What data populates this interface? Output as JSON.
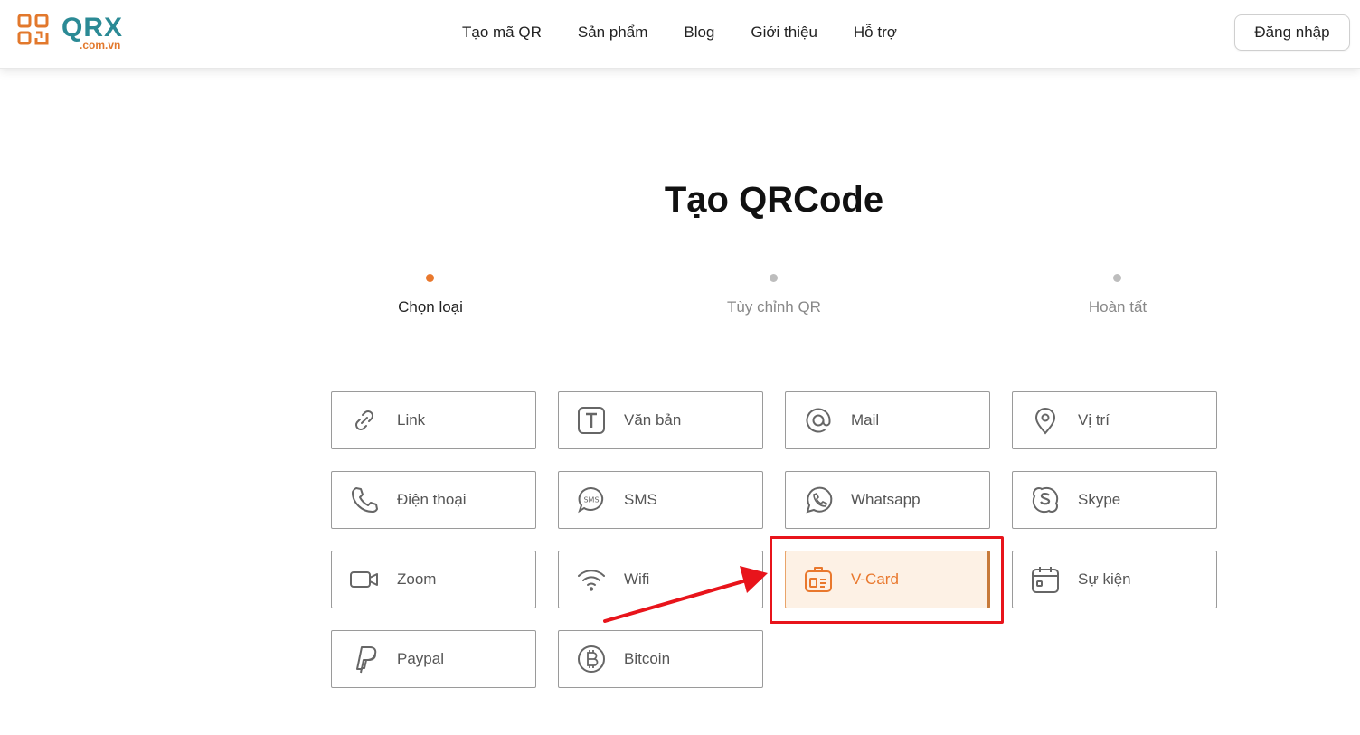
{
  "header": {
    "logo_text": "QRX",
    "logo_domain": ".com.vn",
    "nav": [
      {
        "label": "Tạo mã QR"
      },
      {
        "label": "Sản phẩm"
      },
      {
        "label": "Blog"
      },
      {
        "label": "Giới thiệu"
      },
      {
        "label": "Hỗ trợ"
      }
    ],
    "login_label": "Đăng nhập"
  },
  "main": {
    "title": "Tạo QRCode",
    "steps": [
      {
        "label": "Chọn loại",
        "active": true
      },
      {
        "label": "Tùy chỉnh QR",
        "active": false
      },
      {
        "label": "Hoàn tất",
        "active": false
      }
    ],
    "types": [
      {
        "label": "Link",
        "icon": "link-icon"
      },
      {
        "label": "Văn bản",
        "icon": "text-icon"
      },
      {
        "label": "Mail",
        "icon": "at-icon"
      },
      {
        "label": "Vị trí",
        "icon": "location-pin-icon"
      },
      {
        "label": "Điện thoại",
        "icon": "phone-icon"
      },
      {
        "label": "SMS",
        "icon": "sms-icon"
      },
      {
        "label": "Whatsapp",
        "icon": "whatsapp-icon"
      },
      {
        "label": "Skype",
        "icon": "skype-icon"
      },
      {
        "label": "Zoom",
        "icon": "video-camera-icon"
      },
      {
        "label": "Wifi",
        "icon": "wifi-icon"
      },
      {
        "label": "V-Card",
        "icon": "id-card-icon",
        "selected": true
      },
      {
        "label": "Sự kiện",
        "icon": "calendar-icon"
      },
      {
        "label": "Paypal",
        "icon": "paypal-icon"
      },
      {
        "label": "Bitcoin",
        "icon": "bitcoin-icon"
      }
    ]
  },
  "colors": {
    "brand_teal": "#2b8a95",
    "brand_orange": "#e9782d",
    "selected_bg": "#fdf1e5",
    "annotation_red": "#e8141b"
  }
}
